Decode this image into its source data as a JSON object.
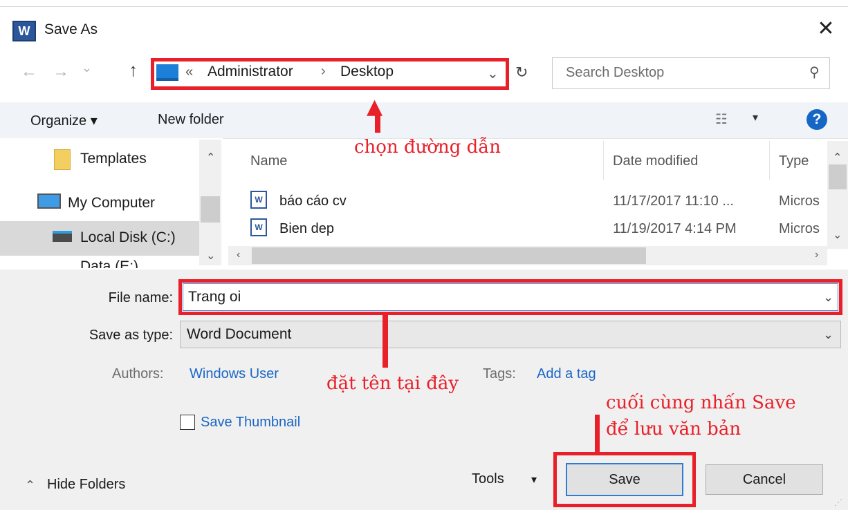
{
  "window": {
    "app_icon_letter": "W",
    "title": "Save As",
    "close_glyph": "✕"
  },
  "nav": {
    "back_glyph": "←",
    "forward_glyph": "→",
    "history_glyph": "⌄",
    "up_glyph": "↑",
    "breadcrumb_chevron": "«",
    "breadcrumb": [
      "Administrator",
      "Desktop"
    ],
    "separator": "›",
    "dropdown_glyph": "⌄",
    "refresh_glyph": "↻",
    "search_placeholder": "Search Desktop",
    "search_glyph": "⚲"
  },
  "toolbar": {
    "organize_label": "Organize ▾",
    "new_folder_label": "New folder",
    "view_glyph": "☷",
    "view_drop_glyph": "▾",
    "help_glyph": "?"
  },
  "sidebar": {
    "items": [
      {
        "label": "Templates",
        "icon": "folder-icon"
      },
      {
        "label": "My Computer",
        "icon": "computer-icon"
      },
      {
        "label": "Local Disk (C:)",
        "icon": "disk-icon",
        "selected": true
      },
      {
        "label": "Data (E:)",
        "icon": "disk-icon"
      }
    ],
    "scroll_up": "⌃",
    "scroll_down": "⌄"
  },
  "file_list": {
    "columns": [
      "Name",
      "Date modified",
      "Type"
    ],
    "rows": [
      {
        "name": "báo cáo cv",
        "date": "11/17/2017 11:10 ...",
        "type": "Micros"
      },
      {
        "name": "Bien dep",
        "date": "11/19/2017 4:14 PM",
        "type": "Micros"
      }
    ],
    "icon_letter": "W",
    "scroll_up": "⌃",
    "scroll_down": "⌄",
    "scroll_left": "‹",
    "scroll_right": "›"
  },
  "form": {
    "file_name_label": "File name:",
    "file_name_value": "Trang oi",
    "save_type_label": "Save as type:",
    "save_type_value": "Word Document",
    "combo_glyph": "⌄",
    "authors_label": "Authors:",
    "authors_value": "Windows User",
    "tags_label": "Tags:",
    "tags_value": "Add a tag",
    "thumbnail_label": "Save Thumbnail"
  },
  "footer": {
    "hide_folders_glyph": "⌃",
    "hide_folders_label": "Hide Folders",
    "tools_label": "Tools",
    "tools_drop": "▾",
    "save_label": "Save",
    "cancel_label": "Cancel",
    "grip": "⋰"
  },
  "annotations": {
    "path_note": "chọn đường dẫn",
    "name_note": "đặt tên tại đây",
    "save_note_line1": "cuối cùng nhấn Save",
    "save_note_line2": "để lưu văn bản",
    "arrow_glyph": "▲",
    "color": "#e8202a"
  }
}
